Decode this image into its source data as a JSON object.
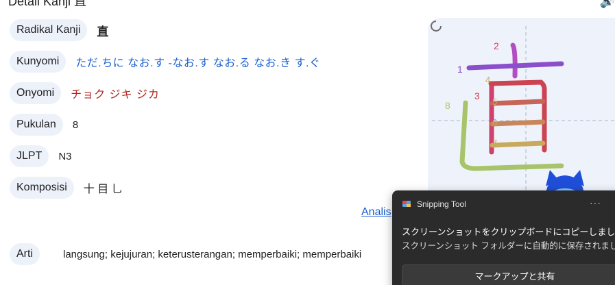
{
  "header": {
    "title": "Detail Kanji 直"
  },
  "details": {
    "radical": {
      "label": "Radikal Kanji",
      "value": "直"
    },
    "kunyomi": {
      "label": "Kunyomi",
      "value": "ただ.ちに  なお.す  -なお.す  なお.る  なお.き  す.ぐ"
    },
    "onyomi": {
      "label": "Onyomi",
      "value": "チョク  ジキ  ジカ"
    },
    "strokes": {
      "label": "Pukulan",
      "value": "8"
    },
    "jlpt": {
      "label": "JLPT",
      "value": "N3"
    },
    "composition": {
      "label": "Komposisi",
      "value": "十 目 乚"
    },
    "analysis_link": "Analis",
    "meaning": {
      "label": "Arti",
      "value": "langsung; kejujuran; keterusterangan; memperbaiki; memperbaiki"
    }
  },
  "stroke_order": {
    "numbers": [
      "1",
      "2",
      "3",
      "4",
      "5",
      "6",
      "7",
      "8"
    ]
  },
  "toast": {
    "app_name": "Snipping Tool",
    "more": "···",
    "title": "スクリーンショットをクリップボードにコピーしました",
    "subtitle": "スクリーンショット フォルダーに自動的に保存されました。",
    "button_label": "マークアップと共有"
  },
  "colors": {
    "chip_bg": "#edf2fa",
    "link_blue": "#1a5fd0",
    "onyomi_red": "#b3261e",
    "toast_bg": "#2b2b2b"
  }
}
